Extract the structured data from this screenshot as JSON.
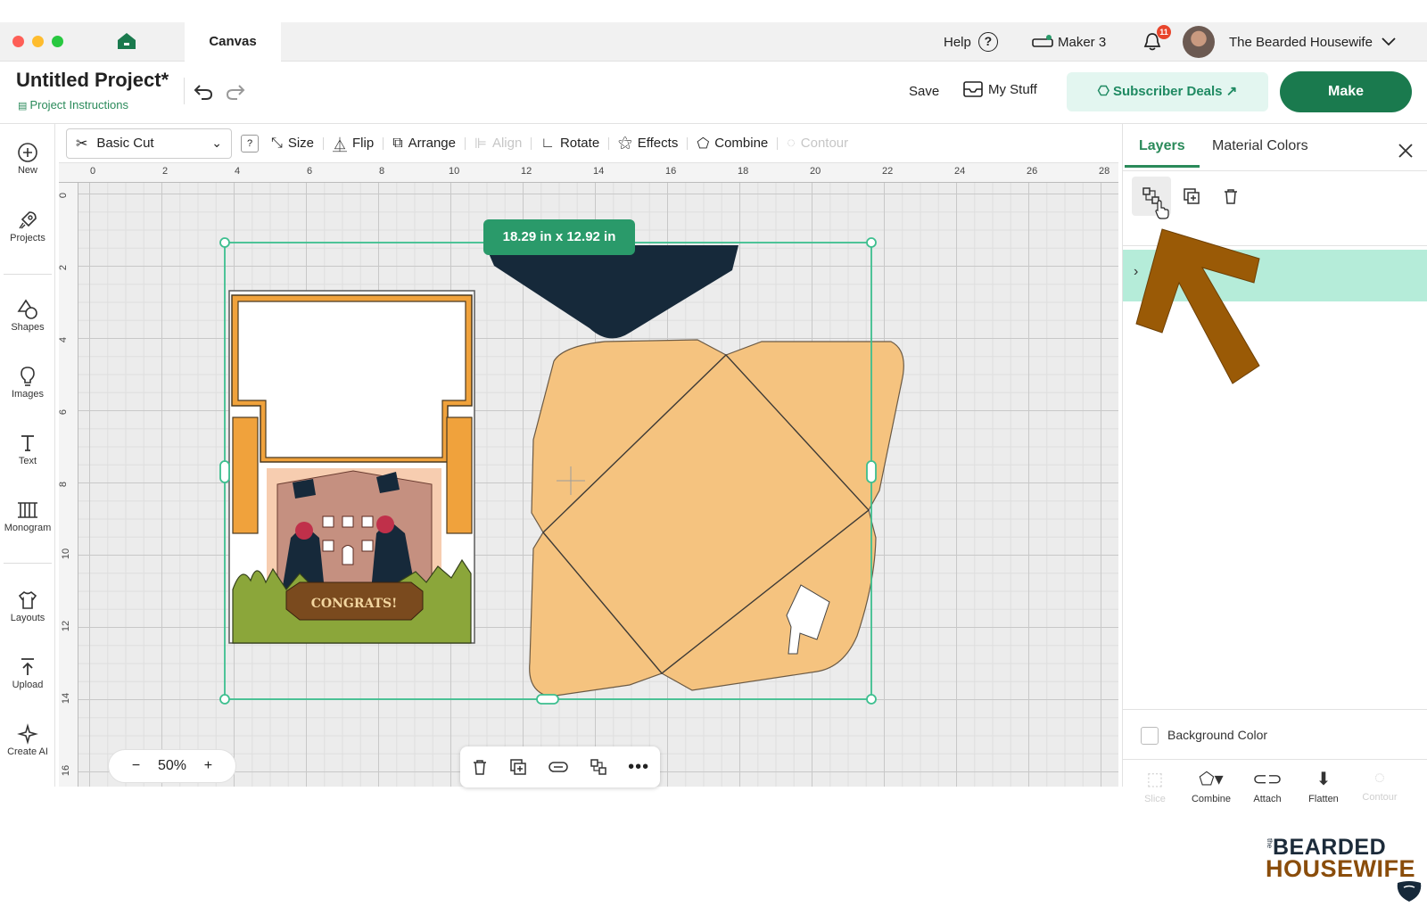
{
  "window": {
    "tab_label": "Canvas",
    "help_label": "Help",
    "help_icon_glyph": "?",
    "machine_label": "Maker 3",
    "notification_count": "11",
    "user_name": "The Bearded Housewife"
  },
  "header": {
    "project_title": "Untitled Project*",
    "project_instructions": "Project Instructions",
    "save_label": "Save",
    "my_stuff_label": "My Stuff",
    "subscriber_deals_label": "Subscriber Deals",
    "make_label": "Make"
  },
  "sidebar": {
    "items": [
      {
        "label": "New",
        "icon": "plus-circle-icon"
      },
      {
        "label": "Projects",
        "icon": "rocket-icon"
      },
      {
        "label": "Shapes",
        "icon": "shapes-icon"
      },
      {
        "label": "Images",
        "icon": "lightbulb-icon"
      },
      {
        "label": "Text",
        "icon": "text-icon"
      },
      {
        "label": "Monogram",
        "icon": "monogram-icon"
      },
      {
        "label": "Layouts",
        "icon": "shirt-icon"
      },
      {
        "label": "Upload",
        "icon": "upload-icon"
      },
      {
        "label": "Create AI",
        "icon": "sparkle-icon"
      }
    ]
  },
  "toolbar": {
    "operation_value": "Basic Cut",
    "help_glyph": "?",
    "size_label": "Size",
    "flip_label": "Flip",
    "arrange_label": "Arrange",
    "align_label": "Align",
    "rotate_label": "Rotate",
    "effects_label": "Effects",
    "combine_label": "Combine",
    "contour_label": "Contour"
  },
  "canvas": {
    "ruler_top": [
      "0",
      "2",
      "4",
      "6",
      "8",
      "10",
      "12",
      "14",
      "16",
      "18",
      "20",
      "22",
      "24",
      "26",
      "28"
    ],
    "ruler_left": [
      "0",
      "2",
      "4",
      "6",
      "8",
      "10",
      "12",
      "14",
      "16"
    ],
    "selection_size": "18.29  in x 12.92  in",
    "congrats_text": "CONGRATS!",
    "zoom_value": "50%",
    "zoom_minus": "−",
    "zoom_plus": "+"
  },
  "panel": {
    "tab_layers": "Layers",
    "tab_material_colors": "Material Colors",
    "background_color_label": "Background Color",
    "bottom_actions": [
      {
        "label": "Slice",
        "enabled": false
      },
      {
        "label": "Combine",
        "enabled": true
      },
      {
        "label": "Attach",
        "enabled": true
      },
      {
        "label": "Flatten",
        "enabled": true
      },
      {
        "label": "Contour",
        "enabled": false
      }
    ]
  },
  "watermark": {
    "prefix": "the",
    "line1": "BEARDED",
    "line2": "HOUSEWIFE"
  },
  "colors": {
    "brand_green": "#1a7a4e",
    "accent_green": "#2a9a6a",
    "layer_highlight": "#b5ecd9",
    "envelope": "#f5c37f",
    "envelope_flap": "#16293a",
    "frame_orange": "#f0a23c",
    "arrow": "#9a5a06"
  }
}
